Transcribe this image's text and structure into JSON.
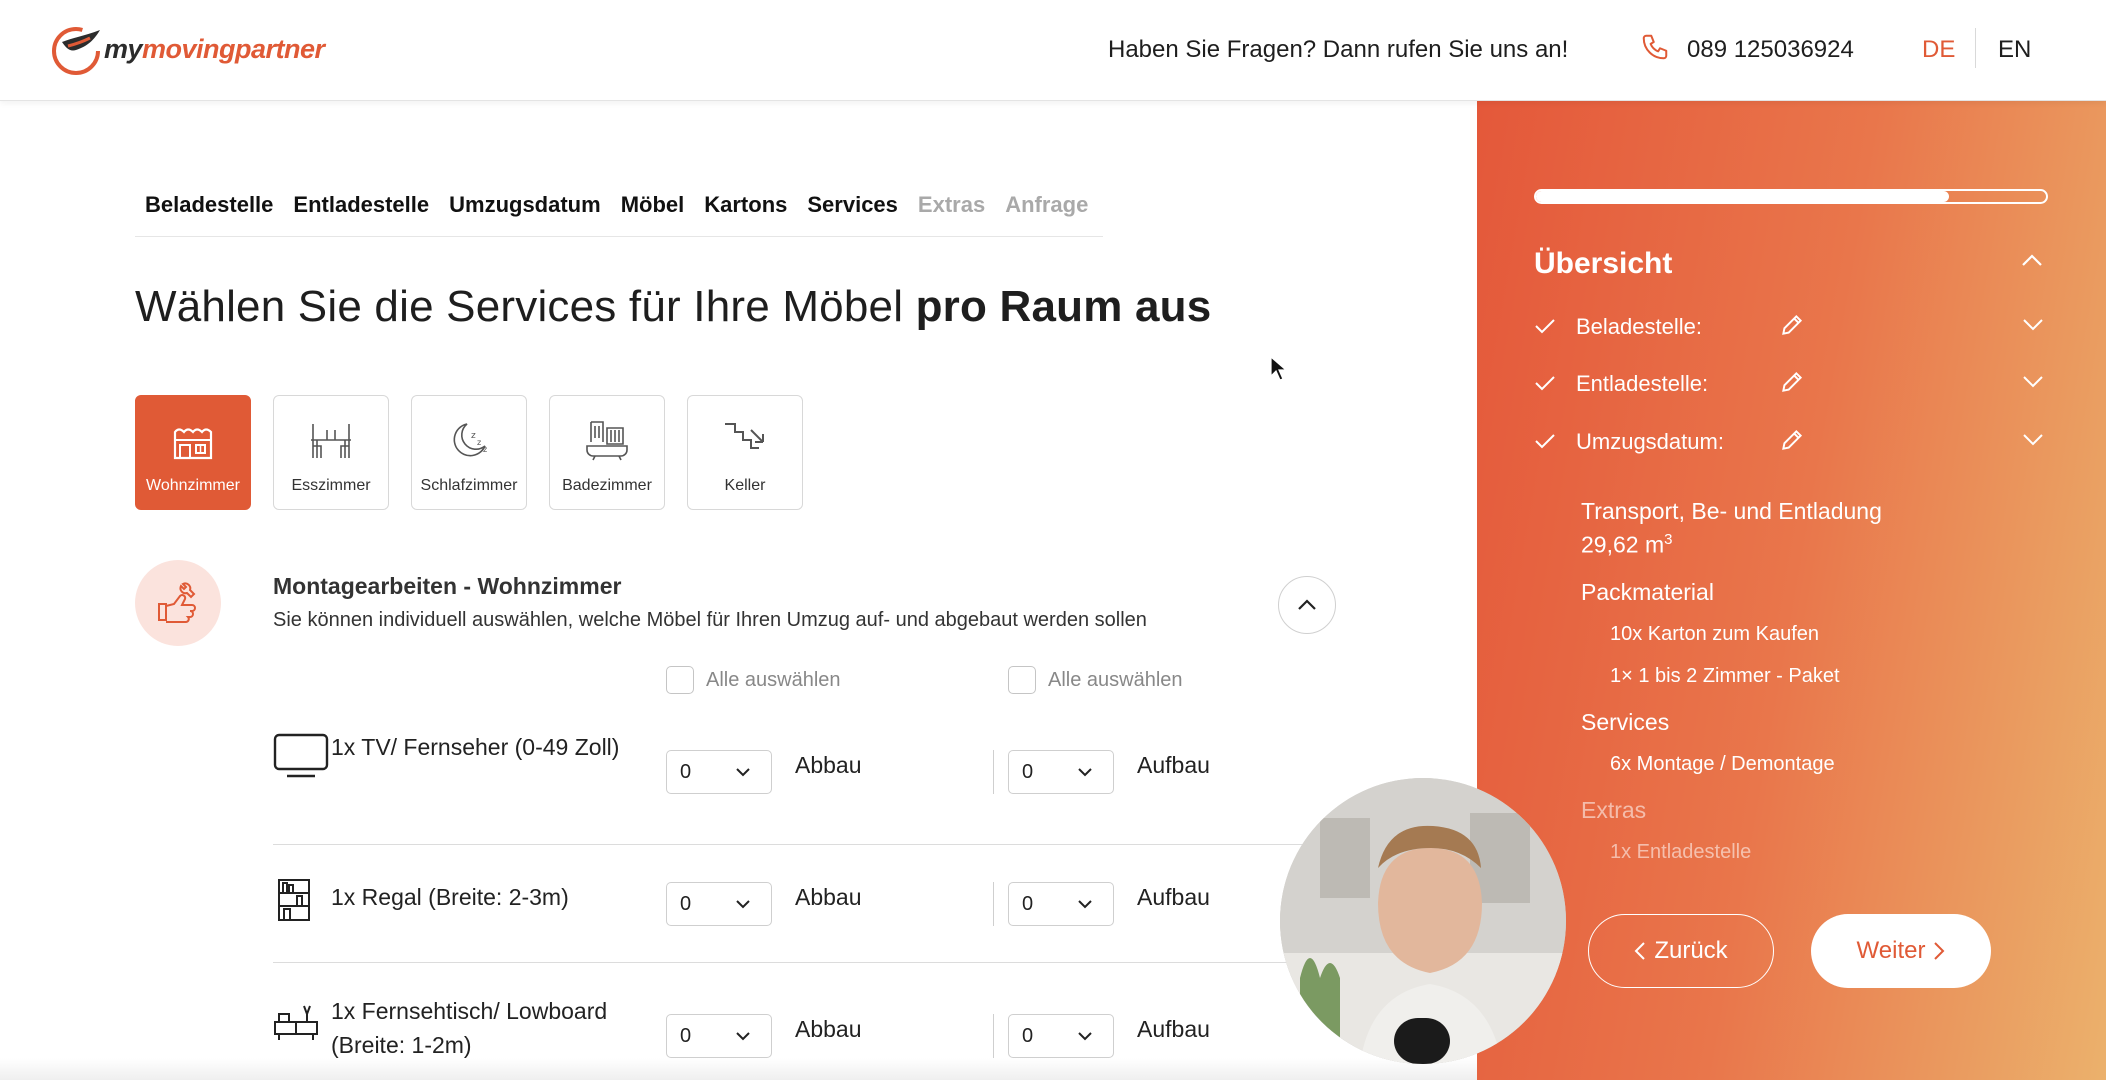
{
  "header": {
    "logo_text_dark": "my",
    "logo_text_brand": "movingpartner",
    "question": "Haben Sie Fragen? Dann rufen Sie uns an!",
    "phone": "089 125036924",
    "lang_de": "DE",
    "lang_en": "EN"
  },
  "steps": [
    {
      "label": "Beladestelle",
      "state": "done"
    },
    {
      "label": "Entladestelle",
      "state": "done"
    },
    {
      "label": "Umzugsdatum",
      "state": "done"
    },
    {
      "label": "Möbel",
      "state": "done"
    },
    {
      "label": "Kartons",
      "state": "done"
    },
    {
      "label": "Services",
      "state": "current"
    },
    {
      "label": "Extras",
      "state": "upcoming"
    },
    {
      "label": "Anfrage",
      "state": "upcoming"
    }
  ],
  "title": {
    "normal": "Wählen Sie die Services für Ihre Möbel ",
    "bold": "pro Raum aus"
  },
  "rooms": [
    {
      "label": "Wohnzimmer",
      "icon": "living-room-icon",
      "active": true
    },
    {
      "label": "Esszimmer",
      "icon": "dining-room-icon",
      "active": false
    },
    {
      "label": "Schlafzimmer",
      "icon": "bedroom-icon",
      "active": false
    },
    {
      "label": "Badezimmer",
      "icon": "bathroom-icon",
      "active": false
    },
    {
      "label": "Keller",
      "icon": "stairs-icon",
      "active": false
    }
  ],
  "section": {
    "title": "Montagearbeiten - Wohnzimmer",
    "description": "Sie können individuell auswählen, welche Möbel für Ihren Umzug auf- und abgebaut werden sollen",
    "select_all_1": "Alle auswählen",
    "select_all_2": "Alle auswählen"
  },
  "items": [
    {
      "label": "1x TV/ Fernseher (0-49 Zoll)",
      "icon": "tv-icon",
      "abbau_value": "0",
      "aufbau_value": "0",
      "abbau_label": "Abbau",
      "aufbau_label": "Aufbau"
    },
    {
      "label": "1x Regal (Breite: 2-3m)",
      "icon": "shelf-icon",
      "abbau_value": "0",
      "aufbau_value": "0",
      "abbau_label": "Abbau",
      "aufbau_label": "Aufbau"
    },
    {
      "label": "1x Fernsehtisch/ Lowboard (Breite: 1-2m)",
      "icon": "lowboard-icon",
      "abbau_value": "0",
      "aufbau_value": "0",
      "abbau_label": "Abbau",
      "aufbau_label": "Aufbau"
    }
  ],
  "sidebar": {
    "progress_percent": 81,
    "title": "Übersicht",
    "rows": [
      {
        "label": "Beladestelle:"
      },
      {
        "label": "Entladestelle:"
      },
      {
        "label": "Umzugsdatum:"
      }
    ],
    "transport_title": "Transport, Be- und Entladung",
    "transport_volume": "29,62 m",
    "transport_unit_sup": "3",
    "packmaterial_title": "Packmaterial",
    "packmaterial_items": [
      "10x Karton zum Kaufen",
      "1× 1 bis 2 Zimmer - Paket"
    ],
    "services_title": "Services",
    "services_items": [
      "6x Montage / Demontage"
    ],
    "extras_title": "Extras",
    "extras_items": [
      "1x Entladestelle"
    ],
    "back_label": "Zurück",
    "next_label": "Weiter"
  },
  "colors": {
    "brand": "#e05a36",
    "sidebar_start": "#e4583a",
    "sidebar_end": "#ebb16c"
  }
}
